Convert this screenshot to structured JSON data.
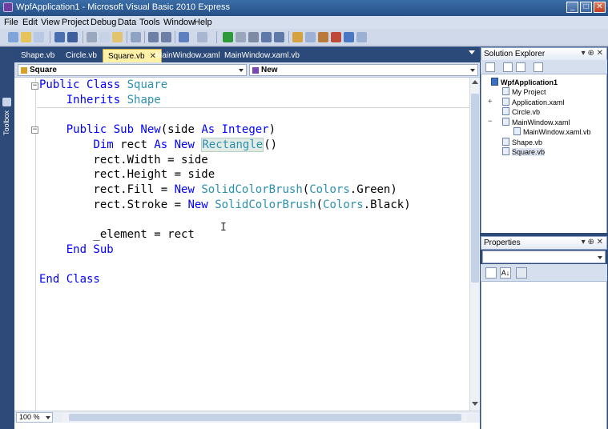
{
  "window": {
    "title": "WpfApplication1 - Microsoft Visual Basic 2010 Express",
    "minimize_glyph": "_",
    "maximize_glyph": "□",
    "close_glyph": "✕"
  },
  "menu": [
    "File",
    "Edit",
    "View",
    "Project",
    "Debug",
    "Data",
    "Tools",
    "Window",
    "Help"
  ],
  "doc_tabs": [
    {
      "label": "Shape.vb",
      "active": false
    },
    {
      "label": "Circle.vb",
      "active": false
    },
    {
      "label": "Square.vb",
      "active": true
    },
    {
      "label": "MainWindow.xaml",
      "active": false
    },
    {
      "label": "MainWindow.xaml.vb",
      "active": false
    }
  ],
  "tab_close_glyph": "✕",
  "nav": {
    "class_combo": "Square",
    "member_combo": "New"
  },
  "code_lines": [
    "Public Class Square",
    "    Inherits Shape",
    "",
    "    Public Sub New(side As Integer)",
    "        Dim rect As New Rectangle()",
    "        rect.Width = side",
    "        rect.Height = side",
    "        rect.Fill = New SolidColorBrush(Colors.Green)",
    "        rect.Stroke = New SolidColorBrush(Colors.Black)",
    "",
    "        _element = rect",
    "    End Sub",
    "",
    "End Class"
  ],
  "fold_glyph": "−",
  "zoom": "100 %",
  "left_strip": {
    "label": "Toolbox"
  },
  "solution_explorer": {
    "title": "Solution Explorer",
    "controls": "▾ ⊕ ✕",
    "tree": [
      {
        "label": "WpfApplication1",
        "level": 0,
        "bold": true,
        "expander": ""
      },
      {
        "label": "My Project",
        "level": 1,
        "expander": ""
      },
      {
        "label": "Application.xaml",
        "level": 1,
        "expander": "+"
      },
      {
        "label": "Circle.vb",
        "level": 1,
        "expander": ""
      },
      {
        "label": "MainWindow.xaml",
        "level": 1,
        "expander": "−"
      },
      {
        "label": "MainWindow.xaml.vb",
        "level": 2,
        "expander": ""
      },
      {
        "label": "Shape.vb",
        "level": 1,
        "expander": ""
      },
      {
        "label": "Square.vb",
        "level": 1,
        "expander": "",
        "selected": true
      }
    ]
  },
  "properties": {
    "title": "Properties",
    "controls": "▾ ⊕ ✕",
    "sort_glyph": "A↓"
  },
  "colors": {
    "keyword": "#0000ff",
    "type": "#2b91af",
    "active_tab": "#fff1a8",
    "chrome_dark": "#2e4a78"
  }
}
